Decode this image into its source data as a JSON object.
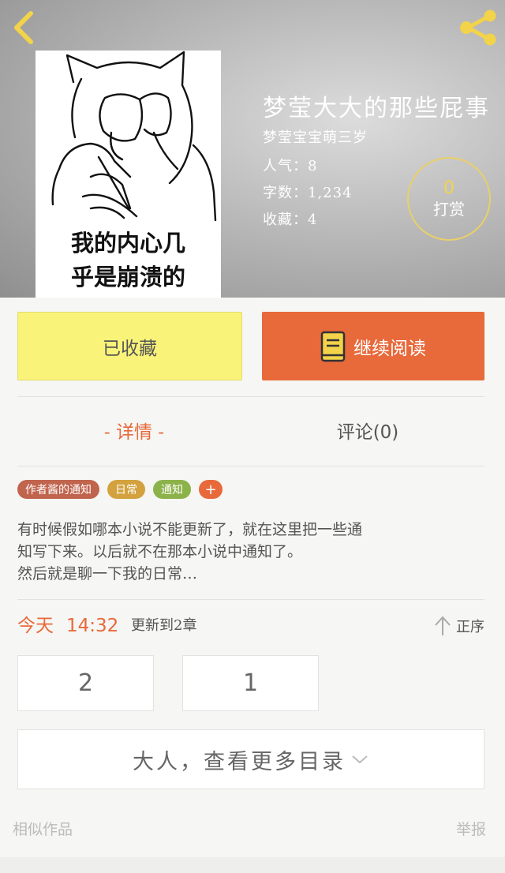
{
  "header": {
    "book_title": "梦莹大大的那些屁事",
    "author": "梦莹宝宝萌三岁",
    "popularity_label": "人气：",
    "popularity": "8",
    "words_label": "字数：",
    "words": "1,234",
    "favorites_label": "收藏：",
    "favorites": "4",
    "tip_count": "0",
    "tip_label": "打赏"
  },
  "cover": {
    "caption_line1": "我的内心几",
    "caption_line2": "乎是崩溃的"
  },
  "actions": {
    "favorite_label": "已收藏",
    "read_label": "继续阅读"
  },
  "tabs": {
    "detail": "- 详情 -",
    "comments": "评论(0)"
  },
  "tags": [
    {
      "label": "作者酱的通知",
      "color": "#c0644e"
    },
    {
      "label": "日常",
      "color": "#d3a23e"
    },
    {
      "label": "通知",
      "color": "#8cb24a"
    }
  ],
  "tag_add": "+",
  "description": {
    "line1": "有时候假如哪本小说不能更新了，就在这里把一些通",
    "line2": "知写下来。以后就不在那本小说中通知了。",
    "line3": "然后就是聊一下我的日常…"
  },
  "update": {
    "day": "今天",
    "time": "14:32",
    "text": "更新到2章",
    "sort_label": "正序"
  },
  "chapters": [
    "2",
    "1"
  ],
  "more_catalog": "大人，查看更多目录",
  "footer": {
    "similar": "相似作品",
    "report": "举报"
  },
  "colors": {
    "accent": "#e8693a",
    "favorite_bg": "#f9f37a",
    "icon_yellow": "#f2d34a"
  }
}
